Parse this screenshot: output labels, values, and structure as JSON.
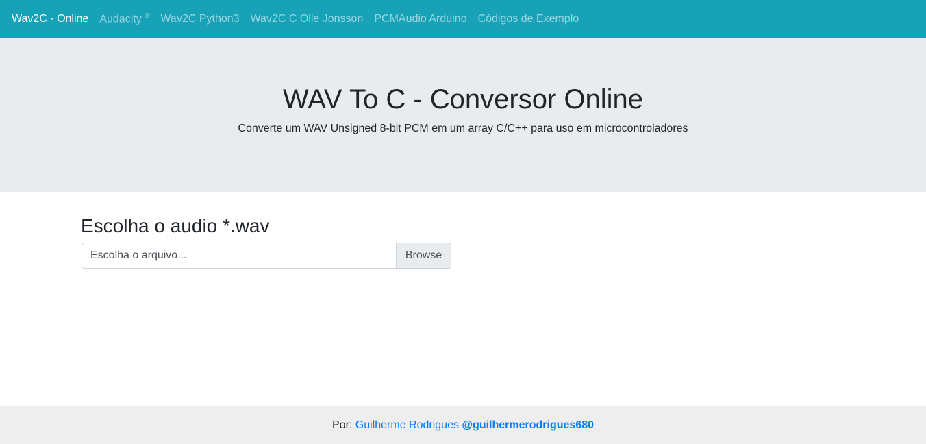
{
  "navbar": {
    "brand": "Wav2C - Online",
    "links": [
      {
        "label": "Audacity",
        "sup": "®"
      },
      {
        "label": "Wav2C Python3"
      },
      {
        "label": "Wav2C C Olle Jonsson"
      },
      {
        "label": "PCMAudio Arduino"
      },
      {
        "label": "Códigos de Exemplo"
      }
    ],
    "bg_color": "#17a2b8"
  },
  "hero": {
    "title": "WAV To C - Conversor Online",
    "subtitle": "Converte um WAV Unsigned 8-bit PCM em um array C/C++ para uso em microcontroladores"
  },
  "upload": {
    "heading": "Escolha o audio *.wav",
    "placeholder": "Escolha o arquivo...",
    "browse_label": "Browse"
  },
  "footer": {
    "prefix": "Por:",
    "author": "Guilherme Rodrigues",
    "handle": "@guilhermerodrigues680",
    "link_color": "#007bff"
  }
}
